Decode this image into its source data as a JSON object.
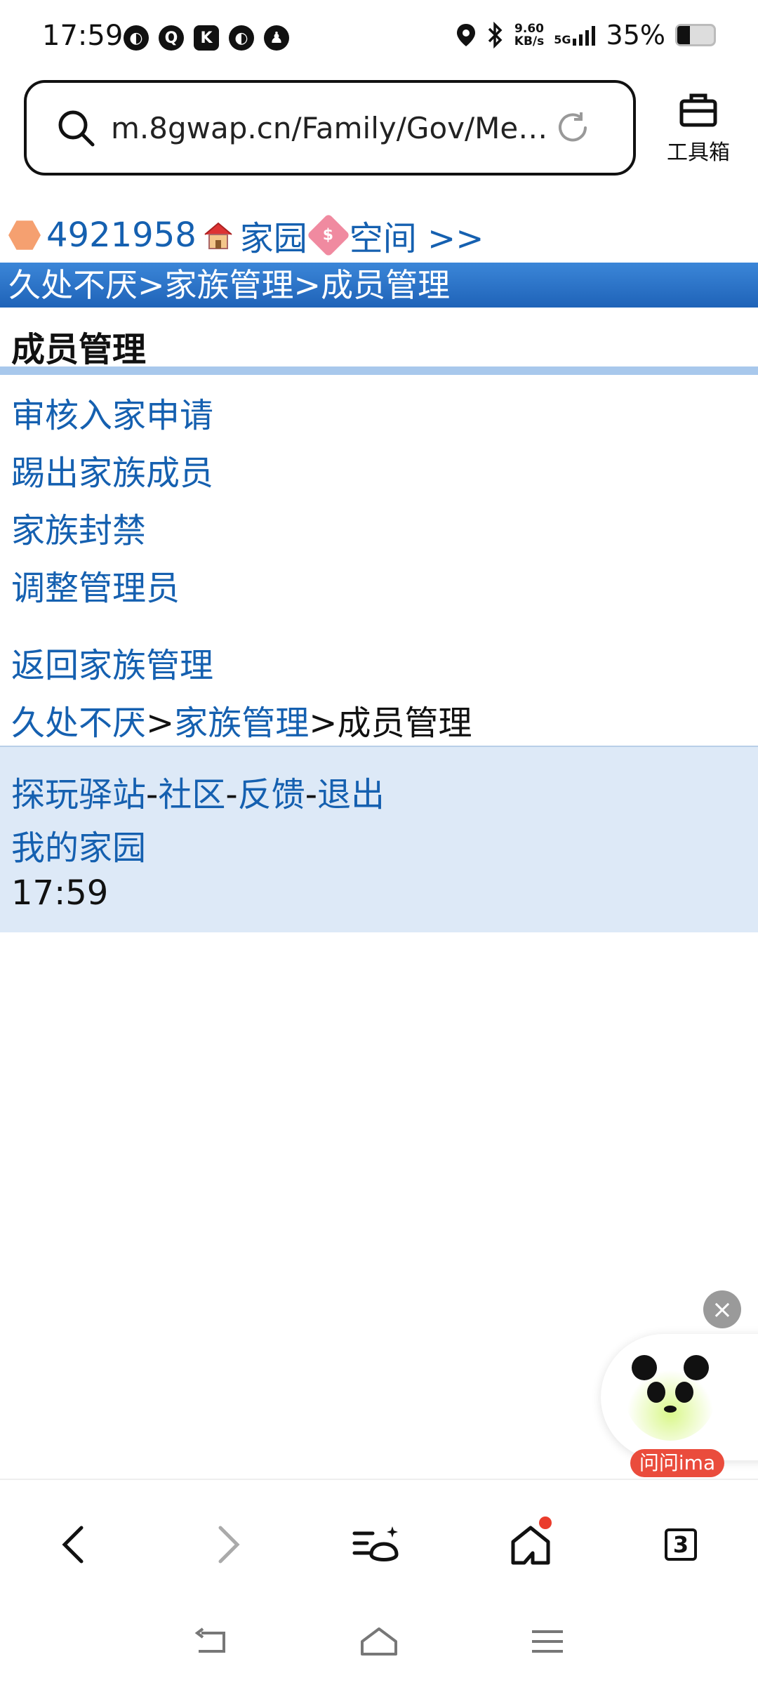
{
  "status_bar": {
    "time": "17:59",
    "left_icons": [
      "browser-icon",
      "q-app-icon",
      "k-app-icon",
      "browser-icon",
      "qq-icon"
    ],
    "speed_top": "9.60",
    "speed_bottom": "KB/s",
    "network": "5G",
    "battery": "35%"
  },
  "address_bar": {
    "url": "m.8gwap.cn/Family/Gov/Me…"
  },
  "toolbox": {
    "label": "工具箱"
  },
  "topline": {
    "user_id": "4921958",
    "home": "家园",
    "space": "空间 >>"
  },
  "title_bar": {
    "text": "久处不厌>家族管理>成员管理"
  },
  "heading": "成员管理",
  "menu": [
    "审核入家申请",
    "踢出家族成员",
    "家族封禁",
    "调整管理员"
  ],
  "back_link": "返回家族管理",
  "breadcrumb": {
    "family": "久处不厌",
    "gt1": ">",
    "manage": "家族管理",
    "gt2": ">",
    "current": "成员管理"
  },
  "footer": {
    "links": [
      "探玩驿站",
      "社区",
      "反馈",
      "退出"
    ],
    "dash": "-",
    "my_home": "我的家园",
    "time": "17:59"
  },
  "floating": {
    "label": "问问ima"
  },
  "browser_nav": {
    "tab_count": "3"
  },
  "colors": {
    "link": "#1560b0",
    "title_bar": "#2a74c8",
    "footer_bg": "#dde9f7"
  }
}
